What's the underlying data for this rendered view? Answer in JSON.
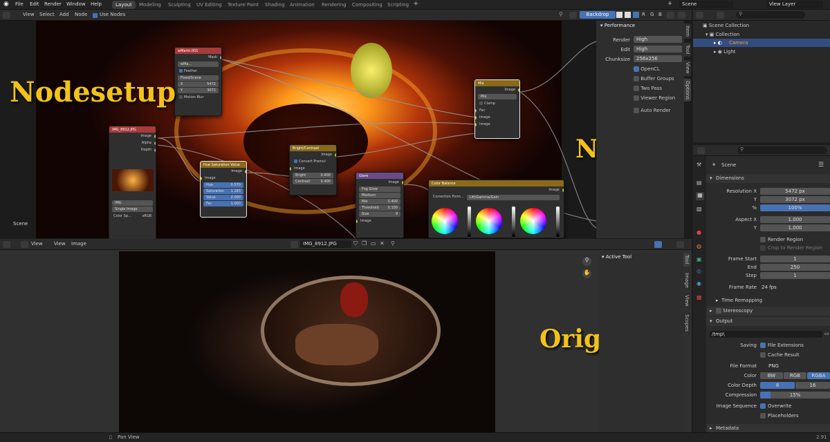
{
  "menu": [
    "File",
    "Edit",
    "Render",
    "Window",
    "Help"
  ],
  "workspaces": [
    "Layout",
    "Modeling",
    "Sculpting",
    "UV Editing",
    "Texture Paint",
    "Shading",
    "Animation",
    "Rendering",
    "Compositing",
    "Scripting"
  ],
  "topright": {
    "scene": "Scene",
    "view_layer": "View Layer"
  },
  "node_header": {
    "items": [
      "View",
      "Select",
      "Add",
      "Node"
    ],
    "use_nodes": "Use Nodes",
    "backdrop": "Backdrop",
    "channels": [
      "R",
      "G",
      "B"
    ]
  },
  "labels": {
    "nodesetup": "Nodesetup",
    "neu": "Neu",
    "original": "Original"
  },
  "scene_label": "Scene",
  "nodes": {
    "mask": {
      "title": "wMarm.001",
      "out": "Mask",
      "name": "wMa...",
      "feather": "Feather",
      "type": "Fixed/Scene",
      "x_label": "X",
      "x": "5472",
      "y_label": "Y",
      "y": "3072",
      "motion": "Motion Blur"
    },
    "image": {
      "title": "IMG_8912.JPG",
      "outs": [
        "Image",
        "Alpha",
        "Depth"
      ],
      "file": "IMG",
      "source": "Single Image",
      "cs_label": "Color Sp...",
      "cs": "sRGB"
    },
    "hsv": {
      "title": "Hue Saturation Value",
      "out": "Image",
      "in": "Image",
      "fields": [
        {
          "l": "Hue",
          "v": "0.570"
        },
        {
          "l": "Saturation",
          "v": "1.283"
        },
        {
          "l": "Value",
          "v": "2.000"
        },
        {
          "l": "Fac",
          "v": "1.000"
        }
      ]
    },
    "bc": {
      "title": "Bright/Contrast",
      "out": "Image",
      "convert": "Convert Premul",
      "in": "Image",
      "fields": [
        {
          "l": "Bright",
          "v": "0.400"
        },
        {
          "l": "Contrast",
          "v": "0.400"
        }
      ]
    },
    "mix": {
      "title": "Mix",
      "out": "Image",
      "mode": "Mix",
      "clamp": "Clamp",
      "ins": [
        "Fac",
        "Image",
        "Image"
      ]
    },
    "glare": {
      "title": "Glare",
      "out": "Image",
      "type": "Fog Glow",
      "quality": "Medium",
      "fields": [
        {
          "l": "Mix",
          "v": "0.400"
        },
        {
          "l": "Threshold",
          "v": "0.100"
        },
        {
          "l": "Size",
          "v": "9"
        }
      ],
      "in": "Image"
    },
    "cb": {
      "title": "Color Balance",
      "out": "Image",
      "label": "Correction Form...",
      "mode": "Lift/Gamma/Gain"
    }
  },
  "performance": {
    "title": "Performance",
    "render_label": "Render",
    "render": "High",
    "edit_label": "Edit",
    "edit": "High",
    "chunk_label": "Chunksize",
    "chunk": "256x256",
    "checks": [
      {
        "l": "OpenCL",
        "on": true
      },
      {
        "l": "Buffer Groups",
        "on": false
      },
      {
        "l": "Two Pass",
        "on": false
      },
      {
        "l": "Viewer Region",
        "on": false
      },
      {
        "l": "Auto Render",
        "on": false
      }
    ]
  },
  "node_tabs": [
    "Item",
    "Tool",
    "View",
    "Options"
  ],
  "image_editor": {
    "menu": [
      "View",
      "View",
      "Image"
    ],
    "image": "IMG_8912.JPG",
    "active_tool": "Active Tool",
    "tabs": [
      "Tool",
      "Image",
      "View",
      "Scopes"
    ]
  },
  "outliner": {
    "root": "Scene Collection",
    "collection": "Collection",
    "items": [
      "Camera",
      "Light"
    ]
  },
  "props": {
    "scene": "Scene",
    "dimensions": "Dimensions",
    "res_x_label": "Resolution X",
    "res_x": "5472 px",
    "res_y_label": "Y",
    "res_y": "3072 px",
    "pct_label": "%",
    "pct": "100%",
    "aspect_x_label": "Aspect X",
    "aspect_x": "1.000",
    "aspect_y_label": "Y",
    "aspect_y": "1.000",
    "render_region": "Render Region",
    "crop": "Crop to Render Region",
    "fs_label": "Frame Start",
    "fs": "1",
    "end_label": "End",
    "end": "250",
    "step_label": "Step",
    "step": "1",
    "rate_label": "Frame Rate",
    "rate": "24 fps",
    "remap": "Time Remapping",
    "stereo": "Stereoscopy",
    "output": "Output",
    "path": "/tmp\\",
    "saving": "Saving",
    "ext": "File Extensions",
    "cache": "Cache Result",
    "ff_label": "File Format",
    "ff": "PNG",
    "color_label": "Color",
    "colors": [
      "BW",
      "RGB",
      "RGBA"
    ],
    "depth_label": "Color Depth",
    "depths": [
      "8",
      "16"
    ],
    "comp_label": "Compression",
    "comp": "15%",
    "seq_label": "Image Sequence",
    "overwrite": "Overwrite",
    "placeholders": "Placeholders",
    "metadata": "Metadata"
  },
  "status": {
    "pan": "Pan View",
    "version": "2.91"
  }
}
